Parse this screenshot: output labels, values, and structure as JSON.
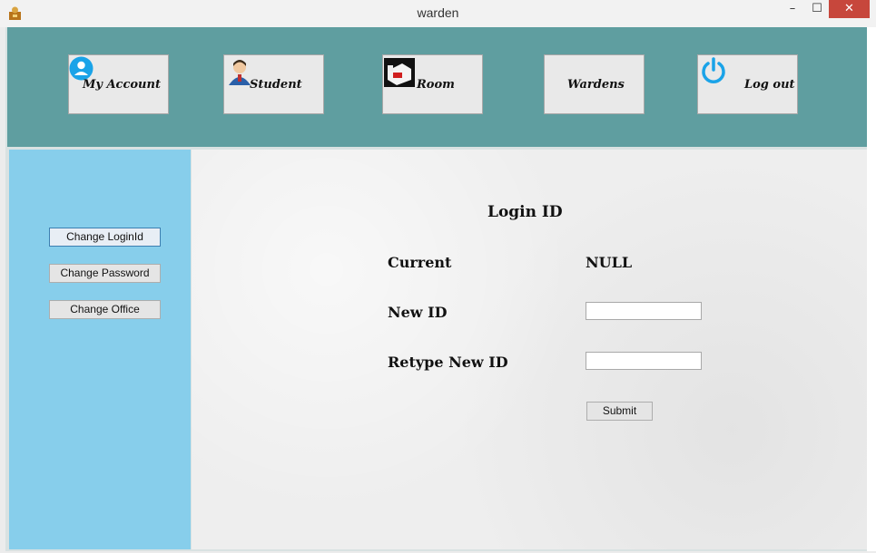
{
  "window": {
    "title": "warden",
    "controls": {
      "minimize": "–",
      "maximize": "☐",
      "close": "✕"
    }
  },
  "topnav": {
    "items": [
      {
        "label": "My Account",
        "icon": "user-circle-icon"
      },
      {
        "label": "Student",
        "icon": "student-icon"
      },
      {
        "label": "Room",
        "icon": "room-icon"
      },
      {
        "label": "Wardens",
        "icon": ""
      },
      {
        "label": "Log out",
        "icon": "power-icon"
      }
    ]
  },
  "sidebar": {
    "items": [
      {
        "label": "Change LoginId"
      },
      {
        "label": "Change Password"
      },
      {
        "label": "Change Office"
      }
    ]
  },
  "form": {
    "heading": "Login ID",
    "current_label": "Current",
    "current_value": "NULL",
    "new_id_label": "New ID",
    "new_id_value": "",
    "retype_label": "Retype New ID",
    "retype_value": "",
    "submit_label": "Submit"
  },
  "colors": {
    "topnav_bg": "#5f9ea0",
    "sidebar_bg": "#87ceeb",
    "close_button": "#c7473c"
  }
}
